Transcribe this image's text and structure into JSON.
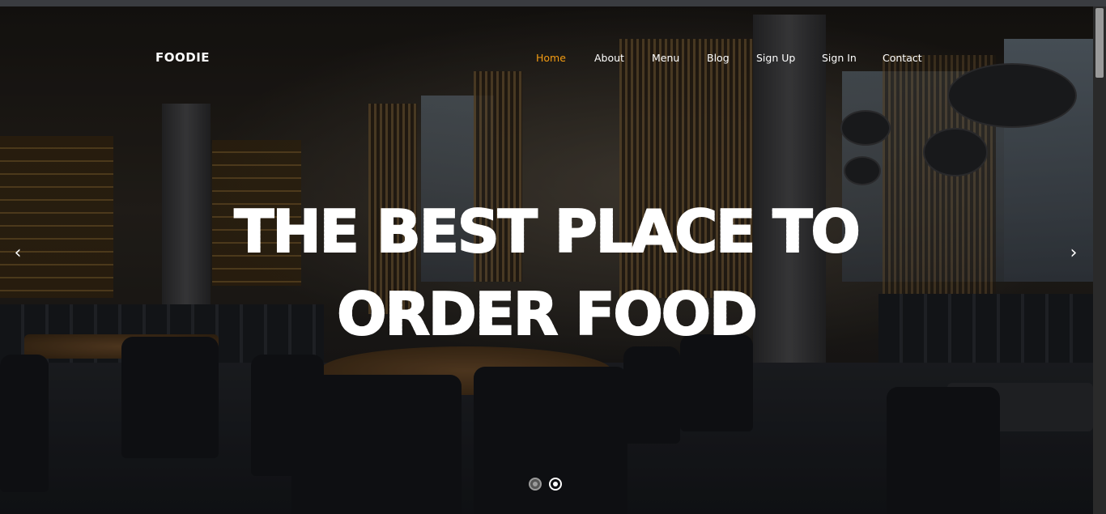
{
  "brand": {
    "name": "FOODIE"
  },
  "nav": {
    "items": [
      {
        "label": "Home",
        "active": true
      },
      {
        "label": "About",
        "active": false
      },
      {
        "label": "Menu",
        "active": false
      },
      {
        "label": "Blog",
        "active": false
      },
      {
        "label": "Sign Up",
        "active": false
      },
      {
        "label": "Sign In",
        "active": false
      },
      {
        "label": "Contact",
        "active": false
      }
    ],
    "active_color": "#f39c12"
  },
  "hero": {
    "line1": "THE BEST PLACE TO",
    "line2": "ORDER FOOD",
    "prev_icon": "chevron-left-icon",
    "next_icon": "chevron-right-icon",
    "prev_glyph": "‹",
    "next_glyph": "›"
  },
  "carousel": {
    "slides": 2,
    "active_index": 1
  }
}
